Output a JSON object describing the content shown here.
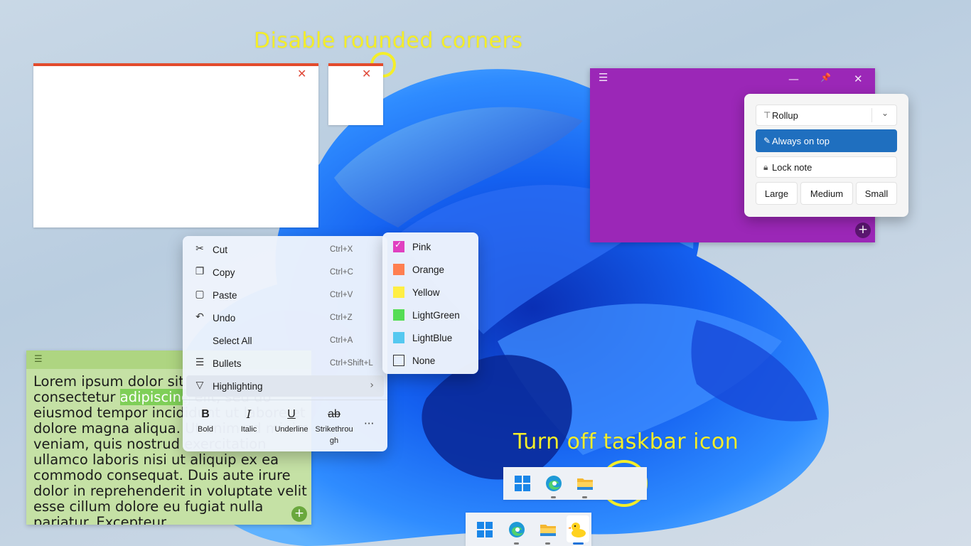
{
  "annotations": {
    "rounded_corners": "Disable rounded corners",
    "taskbar_icon": "Turn off taskbar icon"
  },
  "white_note_large": {
    "close_glyph": "✕"
  },
  "white_note_small": {
    "close_glyph": "✕"
  },
  "purple_note": {
    "color": "#9b27b7",
    "menu_glyph": "☰",
    "minimize_glyph": "—",
    "pin_glyph": "📌",
    "close_glyph": "✕",
    "add_glyph": "+"
  },
  "flyout": {
    "rollup_label": "Rollup",
    "always_on_top_label": "Always on top",
    "lock_note_label": "Lock note",
    "sizes": [
      "Large",
      "Medium",
      "Small"
    ]
  },
  "green_note": {
    "color": "#c5e1a5",
    "text_before": "Lorem ipsum dolor sit amet, consectetur ",
    "text_highlight": "adipiscing",
    "text_after": " elit, sed do eiusmod tempor incididunt ut labore et dolore magna aliqua. Ut enim ad minim veniam, quis nostrud exercitation ullamco laboris nisi ut aliquip ex ea commodo consequat. Duis aute irure dolor in reprehenderit in voluptate velit esse cillum dolore eu fugiat nulla pariatur. Excepteur",
    "add_glyph": "+"
  },
  "context_menu": {
    "items": [
      {
        "label": "Cut",
        "shortcut": "Ctrl+X",
        "icon": "scissors-icon"
      },
      {
        "label": "Copy",
        "shortcut": "Ctrl+C",
        "icon": "copy-icon"
      },
      {
        "label": "Paste",
        "shortcut": "Ctrl+V",
        "icon": "paste-icon"
      },
      {
        "label": "Undo",
        "shortcut": "Ctrl+Z",
        "icon": "undo-icon"
      },
      {
        "label": "Select All",
        "shortcut": "Ctrl+A",
        "icon": ""
      },
      {
        "label": "Bullets",
        "shortcut": "Ctrl+Shift+L",
        "icon": "bullets-icon"
      },
      {
        "label": "Highlighting",
        "shortcut": "",
        "icon": "highlighter-icon"
      }
    ],
    "format_buttons": [
      {
        "glyph": "B",
        "label": "Bold"
      },
      {
        "glyph": "I",
        "label": "Italic"
      },
      {
        "glyph": "U",
        "label": "Underline"
      },
      {
        "glyph": "ab",
        "label": "Strikethrou\ngh"
      }
    ],
    "more_glyph": "···"
  },
  "highlight_menu": {
    "items": [
      {
        "label": "Pink",
        "color": "#e040c0",
        "checked": true
      },
      {
        "label": "Orange",
        "color": "#ff7f50",
        "checked": false
      },
      {
        "label": "Yellow",
        "color": "#ffee44",
        "checked": false
      },
      {
        "label": "LightGreen",
        "color": "#55dd55",
        "checked": false
      },
      {
        "label": "LightBlue",
        "color": "#55c8f0",
        "checked": false
      },
      {
        "label": "None",
        "color": "",
        "checked": false
      }
    ]
  },
  "taskbar_top": {
    "icons": [
      "start-icon",
      "edge-icon",
      "file-explorer-icon"
    ]
  },
  "taskbar_bottom": {
    "icons": [
      "start-icon",
      "edge-icon",
      "file-explorer-icon",
      "duck-app-icon"
    ]
  }
}
